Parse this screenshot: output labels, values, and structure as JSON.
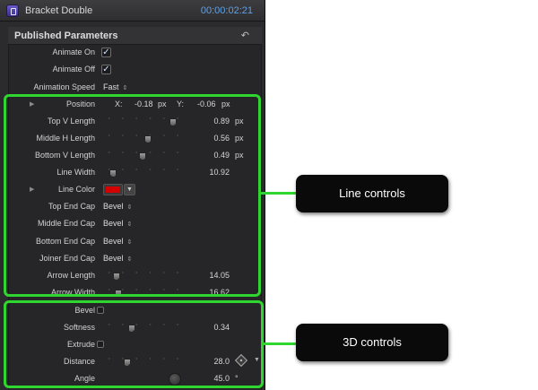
{
  "window": {
    "title": "Bracket Double",
    "timecode": "00:00:02:21"
  },
  "group": {
    "title": "Published Parameters",
    "reset_icon": "reset-arrow-icon"
  },
  "rows": {
    "animate_on": {
      "label": "Animate On",
      "checked": true
    },
    "animate_off": {
      "label": "Animate Off",
      "checked": true
    },
    "animation_speed": {
      "label": "Animation Speed",
      "value": "Fast"
    },
    "position": {
      "label": "Position",
      "x_label": "X:",
      "x_value": "-0.18",
      "x_unit": "px",
      "y_label": "Y:",
      "y_value": "-0.06",
      "y_unit": "px"
    },
    "top_v_length": {
      "label": "Top V Length",
      "value": "0.89",
      "unit": "px",
      "level": 0.89
    },
    "middle_h_length": {
      "label": "Middle H Length",
      "value": "0.56",
      "unit": "px",
      "level": 0.56
    },
    "bottom_v_length": {
      "label": "Bottom V Length",
      "value": "0.49",
      "unit": "px",
      "level": 0.49
    },
    "line_width": {
      "label": "Line Width",
      "value": "10.92",
      "level": 0.1
    },
    "line_color": {
      "label": "Line Color",
      "color": "#d40000"
    },
    "top_end_cap": {
      "label": "Top End Cap",
      "value": "Bevel"
    },
    "middle_end_cap": {
      "label": "Middle End Cap",
      "value": "Bevel"
    },
    "bottom_end_cap": {
      "label": "Bottom End Cap",
      "value": "Bevel"
    },
    "joiner_end_cap": {
      "label": "Joiner End Cap",
      "value": "Bevel"
    },
    "arrow_length": {
      "label": "Arrow Length",
      "value": "14.05",
      "level": 0.14
    },
    "arrow_width": {
      "label": "Arrow Width",
      "value": "16.62",
      "level": 0.17
    },
    "bevel": {
      "label": "Bevel",
      "checked": false
    },
    "softness": {
      "label": "Softness",
      "value": "0.34",
      "level": 0.34
    },
    "extrude": {
      "label": "Extrude",
      "checked": false
    },
    "distance": {
      "label": "Distance",
      "value": "28.0",
      "level": 0.28
    },
    "angle": {
      "label": "Angle",
      "value": "45.0",
      "unit": "°"
    }
  },
  "callouts": {
    "line_controls": "Line controls",
    "controls_3d": "3D controls"
  },
  "colors": {
    "highlight": "#2fd62f",
    "timecode": "#5fa2e6",
    "callout_bg": "#0a0a0a"
  }
}
